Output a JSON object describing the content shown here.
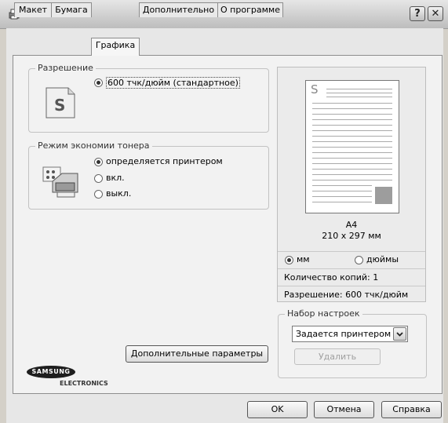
{
  "window": {
    "help_glyph": "?",
    "close_glyph": "✕"
  },
  "tabs": [
    {
      "label": "Макет"
    },
    {
      "label": "Бумага"
    },
    {
      "label": "Графика",
      "active": true
    },
    {
      "label": "Дополнительно"
    },
    {
      "label": "О программе"
    }
  ],
  "resolution": {
    "legend": "Разрешение",
    "option": "600 тчк/дюйм (стандартное)",
    "icon_letter": "S"
  },
  "toner": {
    "legend": "Режим экономии тонера",
    "options": [
      {
        "label": "определяется принтером",
        "selected": true
      },
      {
        "label": "вкл.",
        "selected": false
      },
      {
        "label": "выкл.",
        "selected": false
      }
    ]
  },
  "advanced_button": "Дополнительные параметры",
  "brand": {
    "name": "SAMSUNG",
    "sub": "ELECTRONICS"
  },
  "preview": {
    "sheet_letter": "S",
    "paper": "A4",
    "dimensions": "210 x 297 мм",
    "units": [
      {
        "label": "мм",
        "selected": true
      },
      {
        "label": "дюймы",
        "selected": false
      }
    ],
    "copies": "Количество копий: 1",
    "resolution": "Разрешение: 600 тчк/дюйм"
  },
  "presets": {
    "legend": "Набор настроек",
    "selected": "Задается принтером",
    "delete_label": "Удалить"
  },
  "footer": {
    "ok": "OK",
    "cancel": "Отмена",
    "help": "Справка"
  }
}
